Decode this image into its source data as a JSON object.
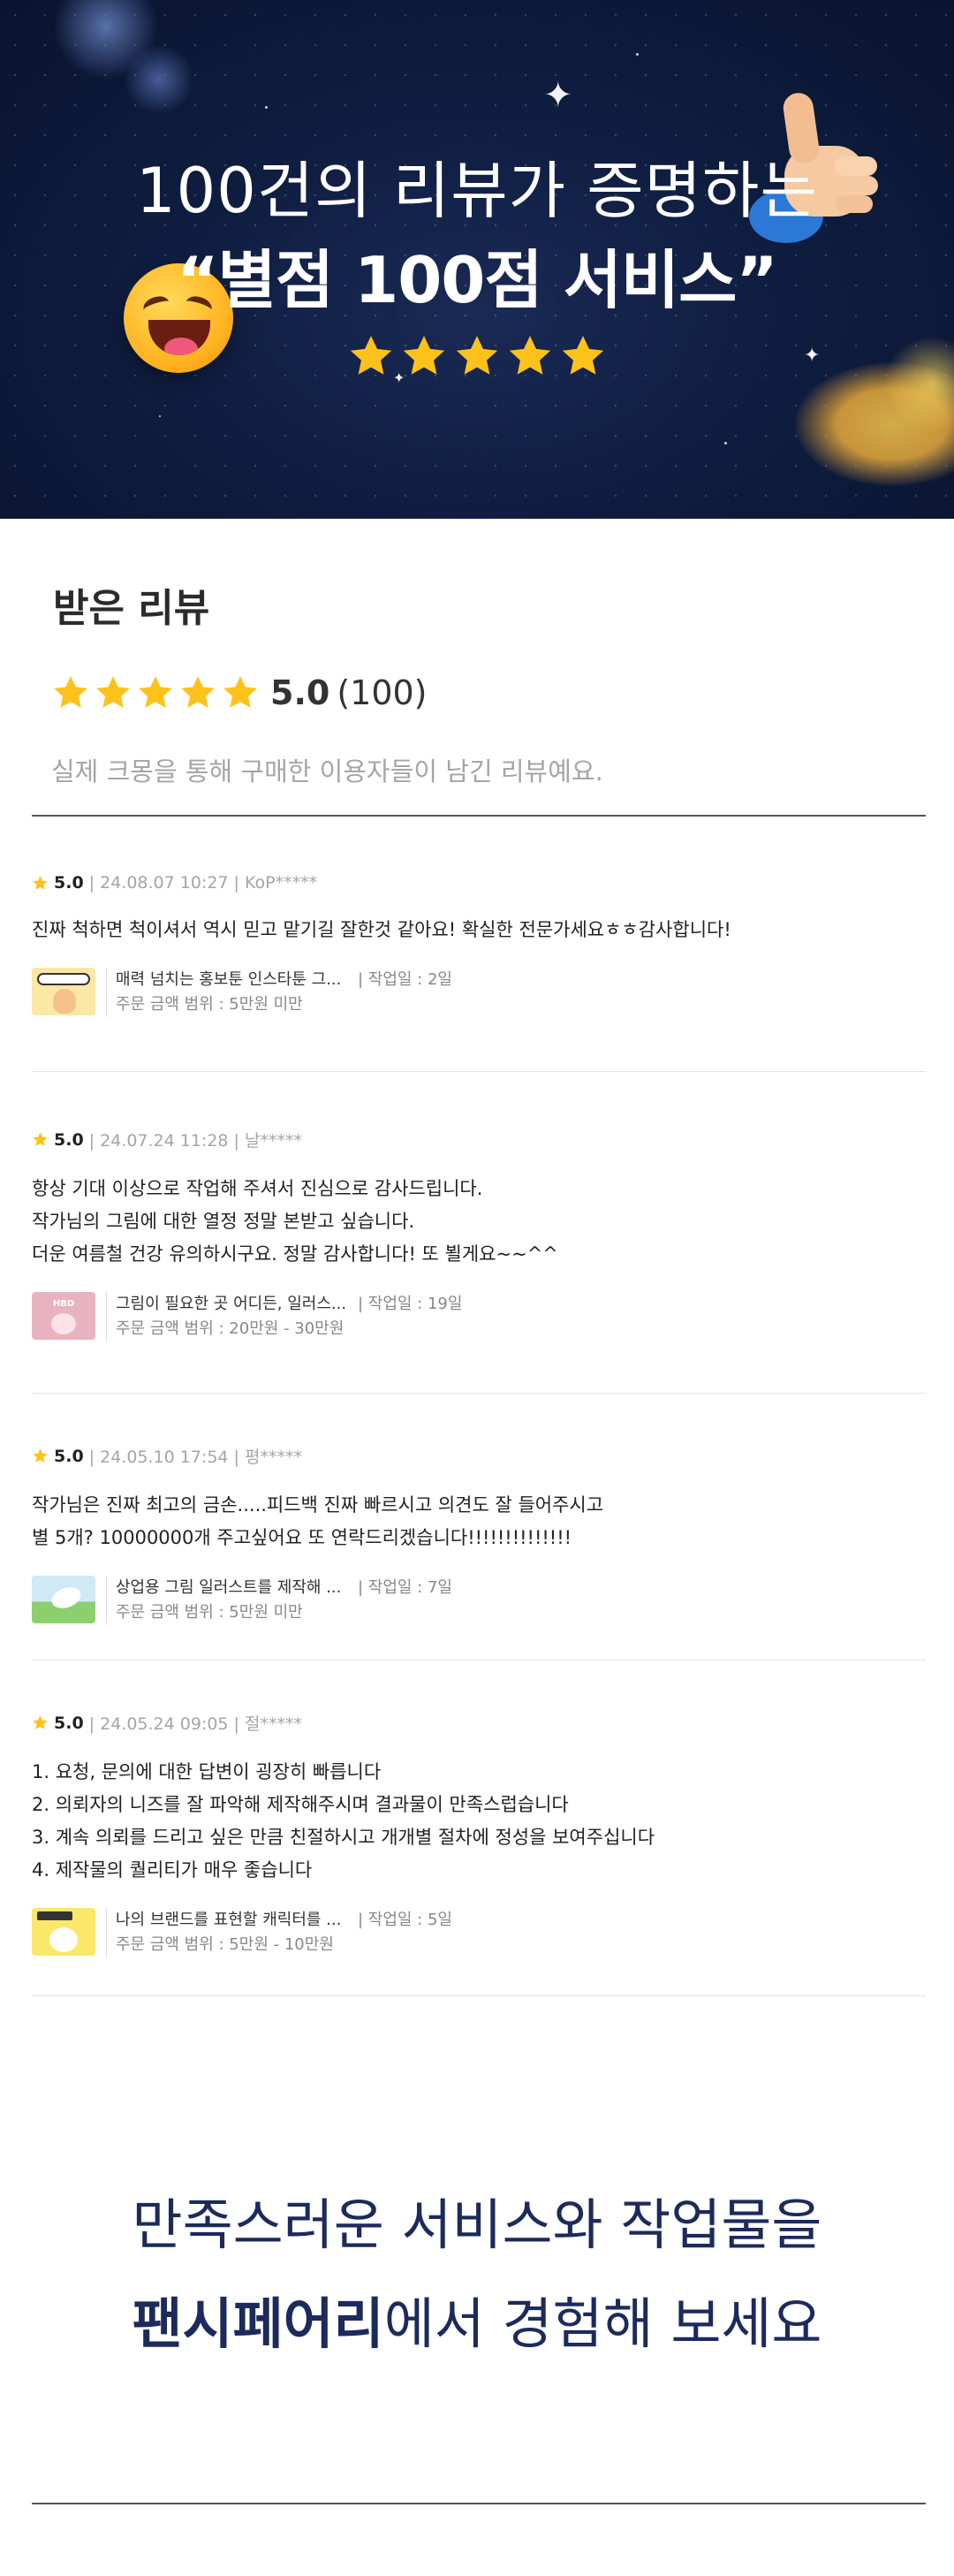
{
  "hero": {
    "line1": "100건의 리뷰가 증명하는",
    "line2": "“별점 100점 서비스”",
    "star_count": 5,
    "colors": {
      "bg": "#0f1d40",
      "star": "#ffc21a"
    },
    "icons": [
      "laughing-emoji-icon",
      "thumbs-up-icon"
    ]
  },
  "reviews_section": {
    "title": "받은 리뷰",
    "rating": "5.0",
    "count": "(100)",
    "stars": 5,
    "description": "실제 크몽을 통해 구매한 이용자들이 남긴 리뷰예요."
  },
  "reviews": [
    {
      "score": "5.0",
      "meta": "| 24.08.07 10:27 | KoP*****",
      "lines": [
        "진짜 척하면 척이셔서 역시 믿고 맡기길 잘한것 같아요! 확실한 전문가세요ㅎㅎ감사합니다!"
      ],
      "product": {
        "name": "매력 넘치는 홍보툰 인스타툰 그...",
        "days": "| 작업일 : 2일",
        "price": "주문 금액 범위 : 5만원 미만"
      }
    },
    {
      "score": "5.0",
      "meta": "| 24.07.24 11:28 | 날*****",
      "lines": [
        "항상 기대 이상으로 작업해 주셔서 진심으로 감사드립니다.",
        "작가님의 그림에 대한 열정 정말 본받고 싶습니다.",
        "더운 여름철 건강 유의하시구요. 정말 감사합니다! 또 뵐게요~~^^"
      ],
      "product": {
        "name": "그림이 필요한 곳 어디든, 일러스...",
        "days": "| 작업일 : 19일",
        "price": "주문 금액 범위 : 20만원 - 30만원"
      }
    },
    {
      "score": "5.0",
      "meta": "| 24.05.10 17:54 | 평*****",
      "lines": [
        "작가님은 진짜 최고의 금손.....피드백 진짜 빠르시고 의견도 잘 들어주시고",
        "별 5개? 10000000개 주고싶어요 또 연락드리겠습니다!!!!!!!!!!!!!!"
      ],
      "product": {
        "name": "상업용 그림 일러스트를 제작해 ...",
        "days": "| 작업일 : 7일",
        "price": "주문 금액 범위 : 5만원 미만"
      }
    },
    {
      "score": "5.0",
      "meta": "| 24.05.24 09:05 | 절*****",
      "lines": [
        "1. 요청, 문의에 대한 답변이 굉장히 빠릅니다",
        "2. 의뢰자의 니즈를 잘 파악해 제작해주시며 결과물이 만족스럽습니다",
        "3. 계속 의뢰를 드리고 싶은 만큼 친절하시고 개개별 절차에 정성을 보여주십니다",
        "4. 제작물의 퀄리티가 매우 좋습니다"
      ],
      "product": {
        "name": "나의 브랜드를 표현할 캐릭터를 ...",
        "days": "| 작업일 : 5일",
        "price": "주문 금액 범위 : 5만원 - 10만원"
      }
    }
  ],
  "cta": {
    "line1": "만족스러운 서비스와 작업물을",
    "brand": "팬시페어리",
    "line2_rest": "에서 경험해 보세요"
  }
}
